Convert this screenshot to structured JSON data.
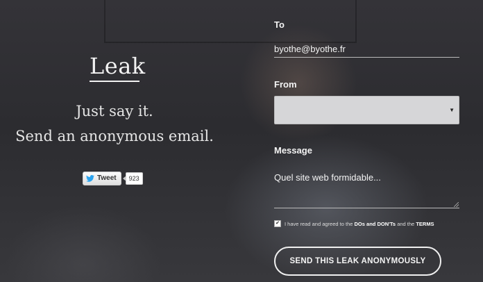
{
  "brand": {
    "logo": "Leak"
  },
  "tagline": {
    "line1": "Just say it.",
    "line2": "Send an anonymous email."
  },
  "tweet": {
    "label": "Tweet",
    "count": "923"
  },
  "form": {
    "to_label": "To",
    "to_value": "byothe@byothe.fr",
    "from_label": "From",
    "from_value": "",
    "message_label": "Message",
    "message_value": "Quel site web formidable...",
    "terms": {
      "checked": true,
      "prefix": "I have read and agreed to the",
      "link1": "DOs and DON'Ts",
      "middle": "and the",
      "link2": "TERMS"
    },
    "submit_label": "SEND THIS LEAK ANONYMOUSLY"
  }
}
